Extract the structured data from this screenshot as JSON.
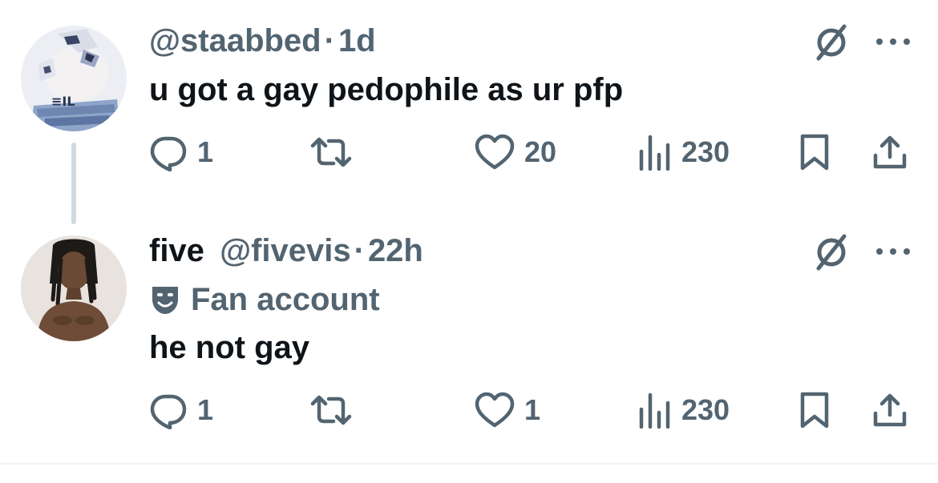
{
  "tweets": [
    {
      "display_name": "",
      "handle": "@staabbed",
      "separator": "·",
      "time": "1d",
      "badge": "",
      "text": "u got a gay pedophile as ur pfp",
      "replies": "1",
      "likes": "20",
      "views": "230"
    },
    {
      "display_name": "five",
      "handle": "@fivevis",
      "separator": "·",
      "time": "22h",
      "badge": "Fan account",
      "text": "he not gay",
      "replies": "1",
      "likes": "1",
      "views": "230"
    }
  ],
  "colors": {
    "text_primary": "#0f1419",
    "text_secondary": "#536471",
    "thread_line": "#cfd9de",
    "background": "#ffffff"
  },
  "icons": {
    "grok": "grok-icon",
    "more": "more-icon",
    "reply": "reply-icon",
    "repost": "repost-icon",
    "like": "like-icon",
    "views": "views-icon",
    "bookmark": "bookmark-icon",
    "share": "share-icon",
    "badge": "theater-mask-icon"
  }
}
